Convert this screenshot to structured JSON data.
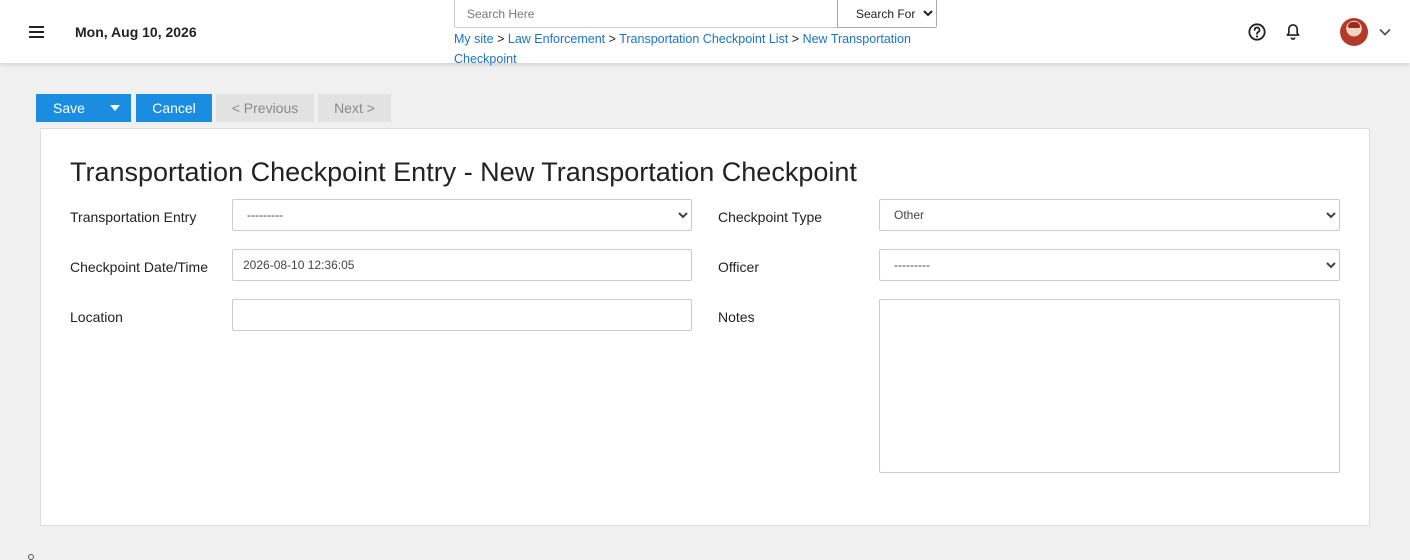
{
  "header": {
    "date": "Mon, Aug 10, 2026",
    "search": {
      "placeholder": "Search Here",
      "value": ""
    },
    "search_for": {
      "selected": "Search For..."
    },
    "breadcrumb": {
      "items": [
        "My site",
        "Law Enforcement",
        "Transportation Checkpoint List",
        "New Transportation Checkpoint"
      ],
      "separator": ">"
    },
    "icons": {
      "menu": "hamburger-menu-icon",
      "help": "help-circle-icon",
      "notifications": "bell-icon",
      "avatar": "user-avatar",
      "caret": "chevron-down-icon"
    }
  },
  "toolbar": {
    "save_label": "Save",
    "cancel_label": "Cancel",
    "previous_label": "< Previous",
    "next_label": "Next >"
  },
  "form": {
    "title": "Transportation Checkpoint Entry - New Transportation Checkpoint",
    "fields": {
      "transportation_entry": {
        "label": "Transportation Entry",
        "selected": "---------"
      },
      "checkpoint_type": {
        "label": "Checkpoint Type",
        "selected": "Other"
      },
      "checkpoint_datetime": {
        "label": "Checkpoint Date/Time",
        "value": "2026-08-10 12:36:05"
      },
      "officer": {
        "label": "Officer",
        "selected": "---------"
      },
      "location": {
        "label": "Location",
        "value": ""
      },
      "notes": {
        "label": "Notes",
        "value": ""
      }
    }
  },
  "colors": {
    "primary": "#1b8de0",
    "link": "#1a73c8",
    "disabled_bg": "#e2e2e2",
    "page_bg": "#f0f0f0"
  }
}
